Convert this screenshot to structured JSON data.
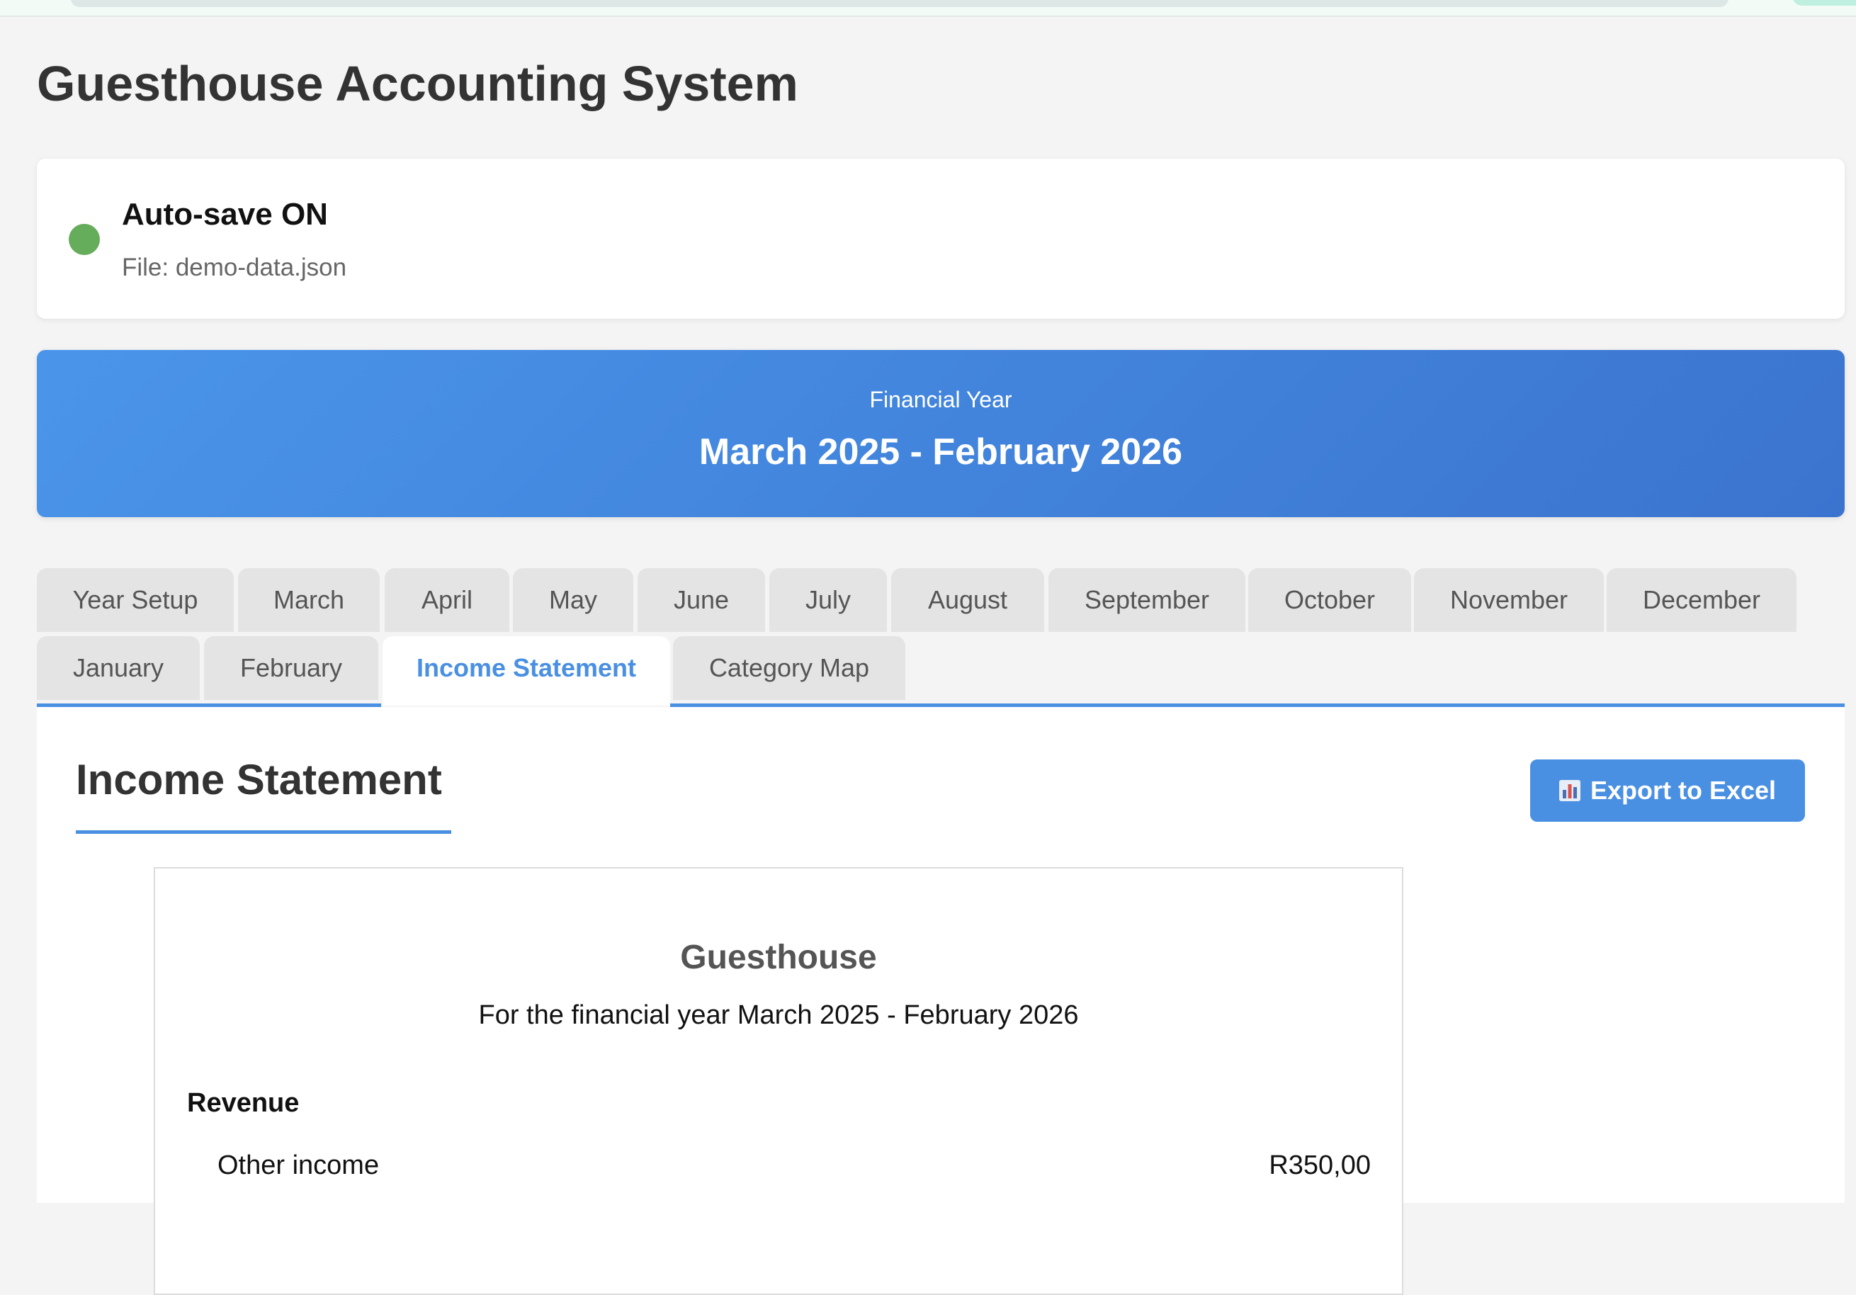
{
  "app": {
    "title": "Guesthouse Accounting System"
  },
  "autosave": {
    "status": "Auto-save ON",
    "file": "File: demo-data.json",
    "status_color": "#65ad5a"
  },
  "financial_year": {
    "label": "Financial Year",
    "range": "March 2025 - February 2026"
  },
  "tabs": [
    {
      "label": "Year Setup",
      "active": false
    },
    {
      "label": "March",
      "active": false
    },
    {
      "label": "April",
      "active": false
    },
    {
      "label": "May",
      "active": false
    },
    {
      "label": "June",
      "active": false
    },
    {
      "label": "July",
      "active": false
    },
    {
      "label": "August",
      "active": false
    },
    {
      "label": "September",
      "active": false
    },
    {
      "label": "October",
      "active": false
    },
    {
      "label": "November",
      "active": false
    },
    {
      "label": "December",
      "active": false
    },
    {
      "label": "January",
      "active": false
    },
    {
      "label": "February",
      "active": false
    },
    {
      "label": "Income Statement",
      "active": true
    },
    {
      "label": "Category Map",
      "active": false
    }
  ],
  "income_statement": {
    "title": "Income Statement",
    "export_label": "Export to Excel",
    "export_icon": "bar-chart-icon",
    "company": "Guesthouse",
    "period": "For the financial year March 2025 - February 2026",
    "sections": [
      {
        "heading": "Revenue",
        "rows": [
          {
            "label": "Other income",
            "value": "R350,00"
          }
        ]
      }
    ]
  },
  "colors": {
    "accent": "#4a90e2",
    "banner_start": "#4a95ea",
    "banner_end": "#3b74cf",
    "tab_inactive": "#e4e4e4"
  }
}
